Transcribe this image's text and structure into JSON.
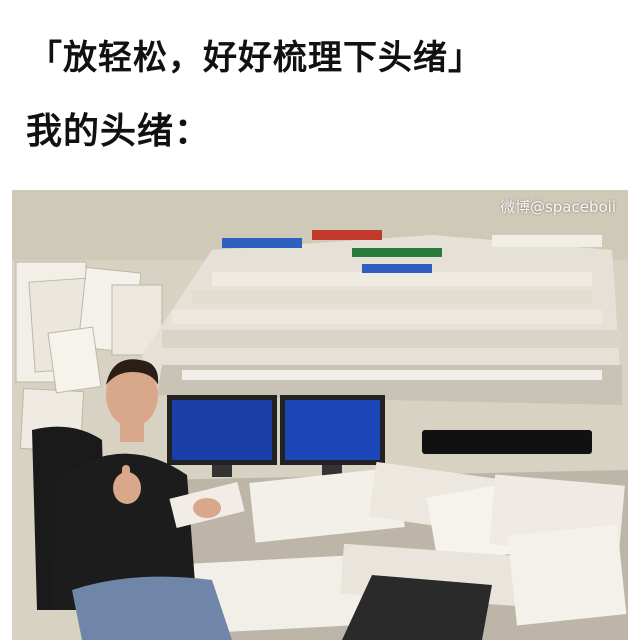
{
  "caption": {
    "line1": "「放轻松，好好梳理下头绪」",
    "line2": "我的头绪："
  },
  "photo": {
    "watermark": "微博@spaceboii",
    "scene_icon": "messy-office-desk-illustration"
  },
  "colors": {
    "background": "#ffffff",
    "text": "#111111",
    "wall": "#d8d2c2",
    "paper": "#eeeae2",
    "monitor_screen": "#1a3ea8",
    "shirt": "#1c1c1c"
  }
}
